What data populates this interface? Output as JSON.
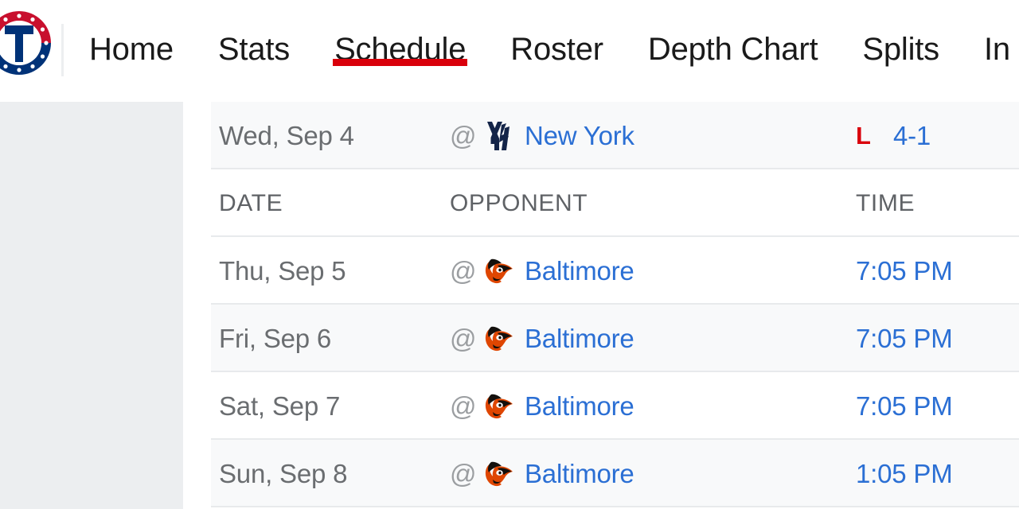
{
  "nav": {
    "logo_icon": "texas-rangers-logo",
    "items": [
      {
        "label": "Home",
        "active": false
      },
      {
        "label": "Stats",
        "active": false
      },
      {
        "label": "Schedule",
        "active": true
      },
      {
        "label": "Roster",
        "active": false
      },
      {
        "label": "Depth Chart",
        "active": false
      },
      {
        "label": "Splits",
        "active": false
      },
      {
        "label": "In",
        "active": false
      }
    ],
    "active_underline_color": "#d9000b"
  },
  "colors": {
    "sidebar_bg": "#eceef0",
    "link_blue": "#2b6fd4",
    "loss_red": "#d9000b",
    "date_gray": "#6a6d70",
    "header_gray": "#5f6266",
    "stripe_bg": "#f8f9fa",
    "divider": "#e8eaec"
  },
  "table": {
    "headers": {
      "date": "DATE",
      "opponent": "OPPONENT",
      "time": "TIME"
    },
    "prev_row": {
      "date": "Wed, Sep 4",
      "at": "@",
      "logo_icon": "yankees-logo",
      "opponent": "New York",
      "result": "L",
      "score": "4-1"
    },
    "rows": [
      {
        "date": "Thu, Sep 5",
        "at": "@",
        "logo_icon": "orioles-logo",
        "opponent": "Baltimore",
        "time": "7:05 PM"
      },
      {
        "date": "Fri, Sep 6",
        "at": "@",
        "logo_icon": "orioles-logo",
        "opponent": "Baltimore",
        "time": "7:05 PM"
      },
      {
        "date": "Sat, Sep 7",
        "at": "@",
        "logo_icon": "orioles-logo",
        "opponent": "Baltimore",
        "time": "7:05 PM"
      },
      {
        "date": "Sun, Sep 8",
        "at": "@",
        "logo_icon": "orioles-logo",
        "opponent": "Baltimore",
        "time": "1:05 PM"
      }
    ]
  }
}
